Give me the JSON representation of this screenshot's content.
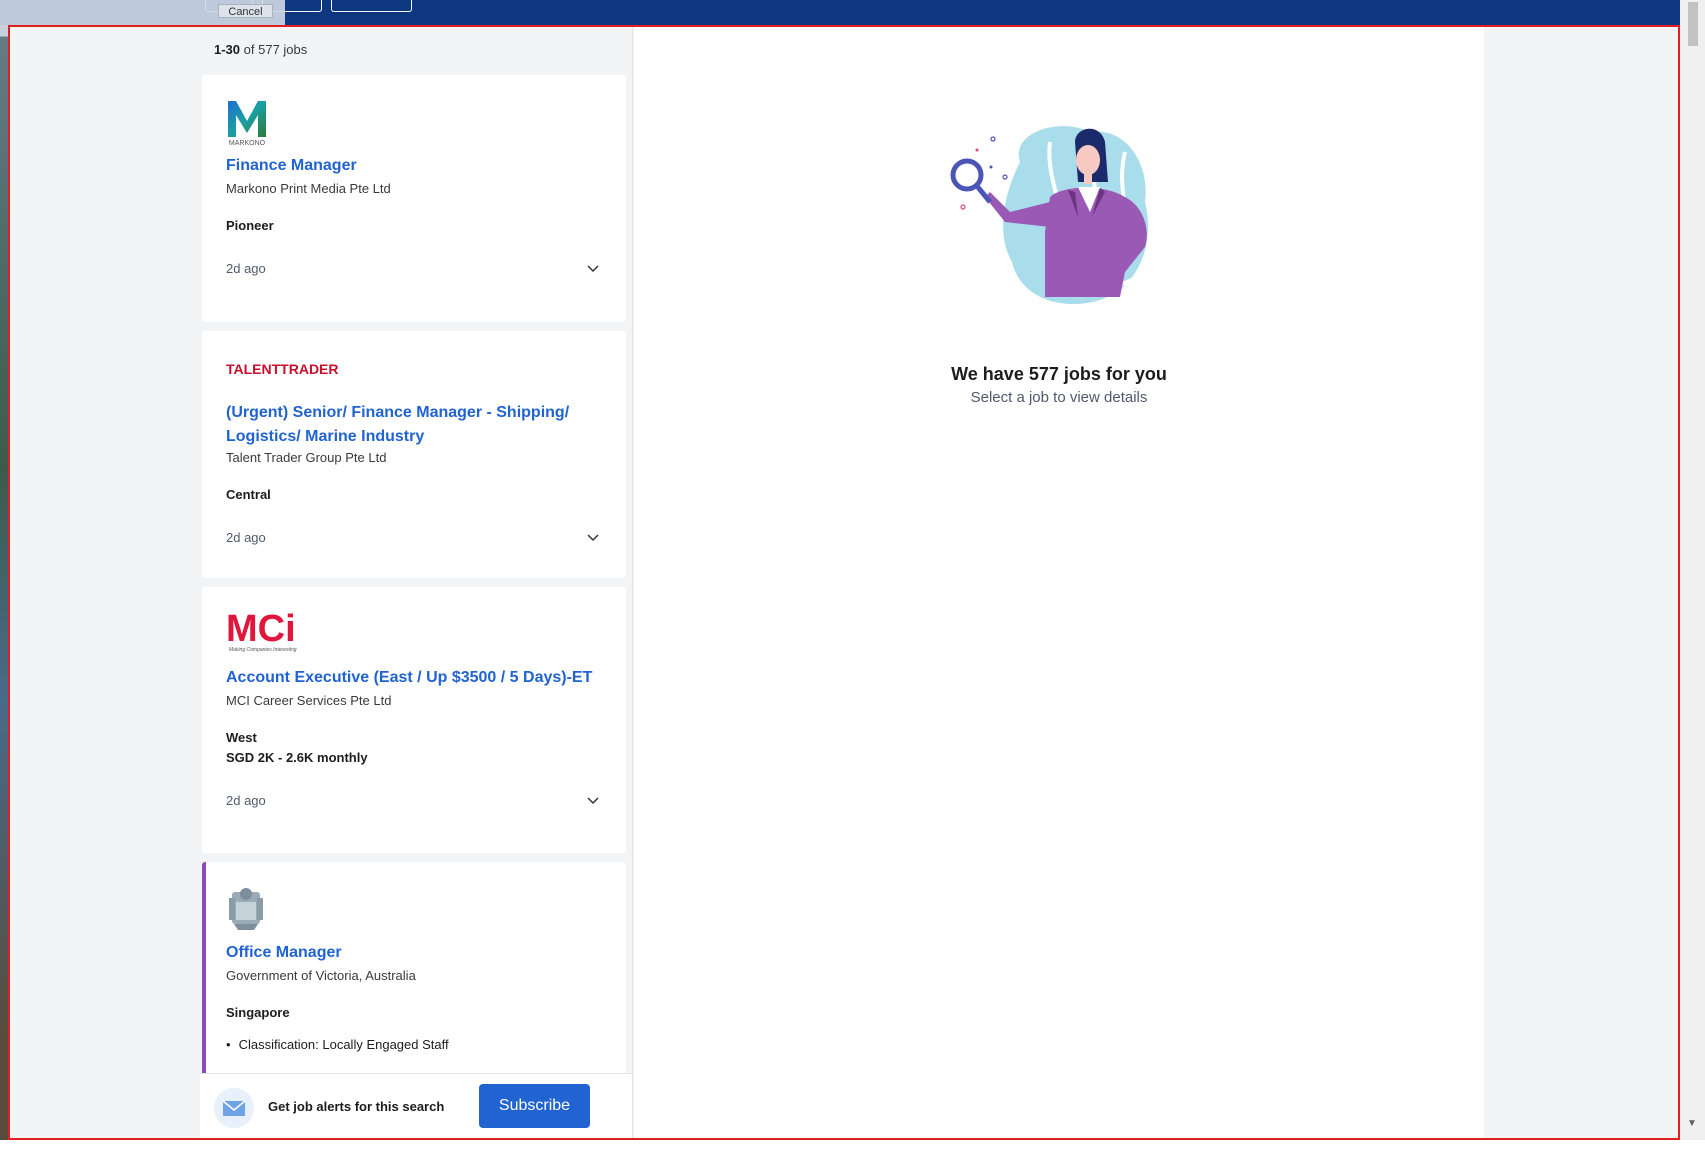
{
  "overlay": {
    "cancel_label": "Cancel"
  },
  "results": {
    "range": "1-30",
    "of_text": "of 577 jobs"
  },
  "jobs": [
    {
      "logo": "MARKONO",
      "title": "Finance Manager",
      "company": "Markono Print Media Pte Ltd",
      "location": "Pioneer",
      "posted": "2d ago"
    },
    {
      "logo": "TALENTTRADER",
      "title": "(Urgent) Senior/ Finance Manager - Shipping/ Logistics/ Marine Industry",
      "company": "Talent Trader Group Pte Ltd",
      "location": "Central",
      "posted": "2d ago"
    },
    {
      "logo": "MCi",
      "logo_tagline": "Making Companies Interesting",
      "title": "Account Executive (East / Up $3500 / 5 Days)-ET",
      "company": "MCI Career Services Pte Ltd",
      "location": "West",
      "salary": "SGD 2K - 2.6K monthly",
      "posted": "2d ago"
    },
    {
      "logo": "victoria-crest",
      "title": "Office Manager",
      "company": "Government of Victoria, Australia",
      "location": "Singapore",
      "bullet": "Classification: Locally Engaged Staff"
    }
  ],
  "alerts": {
    "text": "Get job alerts for this search",
    "subscribe_label": "Subscribe",
    "icon": "mail-icon"
  },
  "detail": {
    "title": "We have 577 jobs for you",
    "subtitle": "Select a job to view details"
  },
  "colors": {
    "brand_blue": "#0d3880",
    "link_blue": "#2063d1",
    "active_purple": "#8a4bb8"
  }
}
